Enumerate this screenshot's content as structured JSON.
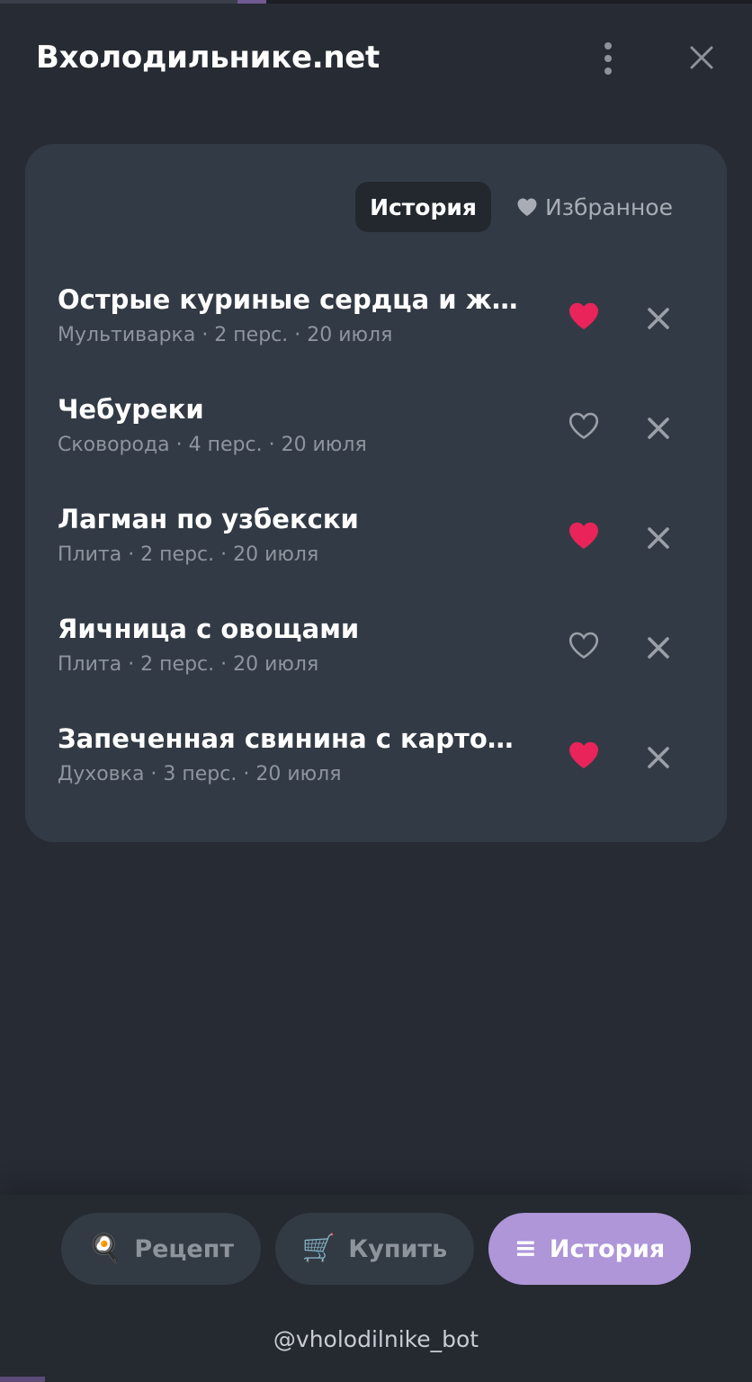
{
  "header": {
    "title": "Вхолодильнике.net",
    "menu_icon": "more-vertical-icon",
    "close_icon": "close-icon"
  },
  "tabs": [
    {
      "label": "История",
      "active": true
    },
    {
      "label": "Избранное",
      "active": false,
      "icon": "heart-icon"
    }
  ],
  "items": [
    {
      "title": "Острые куриные сердца и желудки",
      "meta": "Мультиварка · 2 перс. · 20 июля",
      "favorite": true
    },
    {
      "title": "Чебуреки",
      "meta": "Сковорода · 4 перс. · 20 июля",
      "favorite": false
    },
    {
      "title": "Лагман по узбекски",
      "meta": "Плита · 2 перс. · 20 июля",
      "favorite": true
    },
    {
      "title": "Яичница с овощами",
      "meta": "Плита · 2 перс. · 20 июля",
      "favorite": false
    },
    {
      "title": "Запеченная свинина с картофелем",
      "meta": "Духовка · 3 перс. · 20 июля",
      "favorite": true
    }
  ],
  "nav": {
    "recipe": {
      "label": "Рецепт",
      "icon": "🍳"
    },
    "buy": {
      "label": "Купить",
      "icon": "🛒"
    },
    "history": {
      "label": "История",
      "icon": "≡"
    }
  },
  "footer": {
    "handle": "@vholodilnike_bot"
  },
  "colors": {
    "background": "#272b33",
    "card": "#323b45",
    "heart_active": "#e8245a",
    "accent": "#ae96d8",
    "muted_text": "#8f959e"
  }
}
